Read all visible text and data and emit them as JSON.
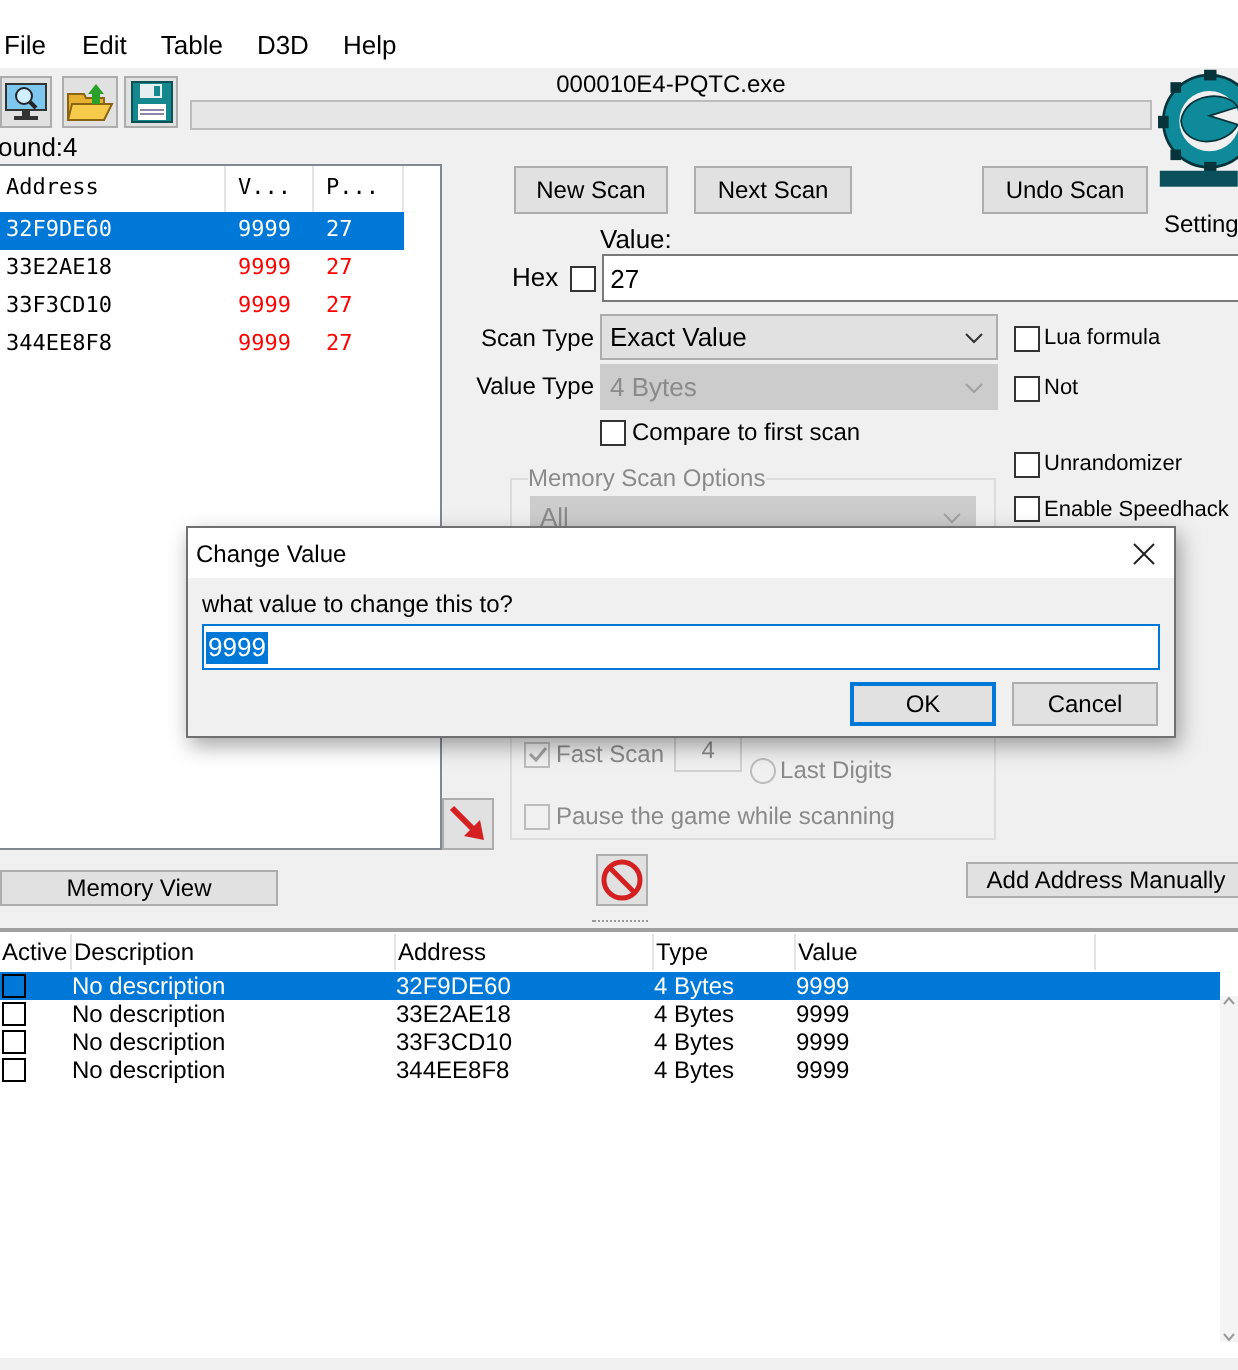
{
  "menu": [
    "File",
    "Edit",
    "Table",
    "D3D",
    "Help"
  ],
  "process": "000010E4-PQTC.exe",
  "progress": {
    "level": 0
  },
  "found": "ound:4",
  "results": {
    "columns": [
      "Address",
      "V...",
      "P..."
    ],
    "rows": [
      {
        "address": "32F9DE60",
        "value": "9999",
        "previous": "27",
        "selected": true,
        "changed": true
      },
      {
        "address": "33E2AE18",
        "value": "9999",
        "previous": "27",
        "selected": false,
        "changed": true
      },
      {
        "address": "33F3CD10",
        "value": "9999",
        "previous": "27",
        "selected": false,
        "changed": true
      },
      {
        "address": "344EE8F8",
        "value": "9999",
        "previous": "27",
        "selected": false,
        "changed": true
      }
    ]
  },
  "scan_buttons": [
    "New Scan",
    "Next Scan",
    "Undo Scan"
  ],
  "settings_label": "Setting",
  "value_label": "Value:",
  "hex": {
    "label": "Hex",
    "checked": false
  },
  "value": "27",
  "scan_type": {
    "label": "Scan Type",
    "value": "Exact Value",
    "disabled": false
  },
  "value_type": {
    "label": "Value Type",
    "value": "4 Bytes",
    "disabled": true
  },
  "compare": {
    "label": "Compare to first scan",
    "checked": false
  },
  "side_options": [
    {
      "label": "Lua formula",
      "checked": false
    },
    {
      "label": "Not",
      "checked": false
    },
    {
      "label": "Unrandomizer",
      "checked": false
    },
    {
      "label": "Enable Speedhack",
      "checked": false
    }
  ],
  "memory_scan_options": {
    "title": "Memory Scan Options",
    "disabled": true,
    "region": "All",
    "fast_scan": {
      "label": "Fast Scan",
      "checked": true
    },
    "alignment_value": "4",
    "last_digits": {
      "label": "Last Digits",
      "selected": false
    },
    "pause": {
      "label": "Pause the game while scanning",
      "checked": false
    }
  },
  "memory_view_button": "Memory View",
  "add_address_button": "Add Address Manually",
  "address_table": {
    "columns": [
      "Active",
      "Description",
      "Address",
      "Type",
      "Value"
    ],
    "rows": [
      {
        "active": false,
        "description": "No description",
        "address": "32F9DE60",
        "type": "4 Bytes",
        "value": "9999",
        "selected": true
      },
      {
        "active": false,
        "description": "No description",
        "address": "33E2AE18",
        "type": "4 Bytes",
        "value": "9999",
        "selected": false
      },
      {
        "active": false,
        "description": "No description",
        "address": "33F3CD10",
        "type": "4 Bytes",
        "value": "9999",
        "selected": false
      },
      {
        "active": false,
        "description": "No description",
        "address": "344EE8F8",
        "type": "4 Bytes",
        "value": "9999",
        "selected": false
      }
    ]
  },
  "dialog": {
    "title": "Change Value",
    "prompt": "what value to change this to?",
    "value": "9999",
    "buttons": [
      {
        "label": "OK",
        "default": true
      },
      {
        "label": "Cancel",
        "default": false
      }
    ]
  }
}
